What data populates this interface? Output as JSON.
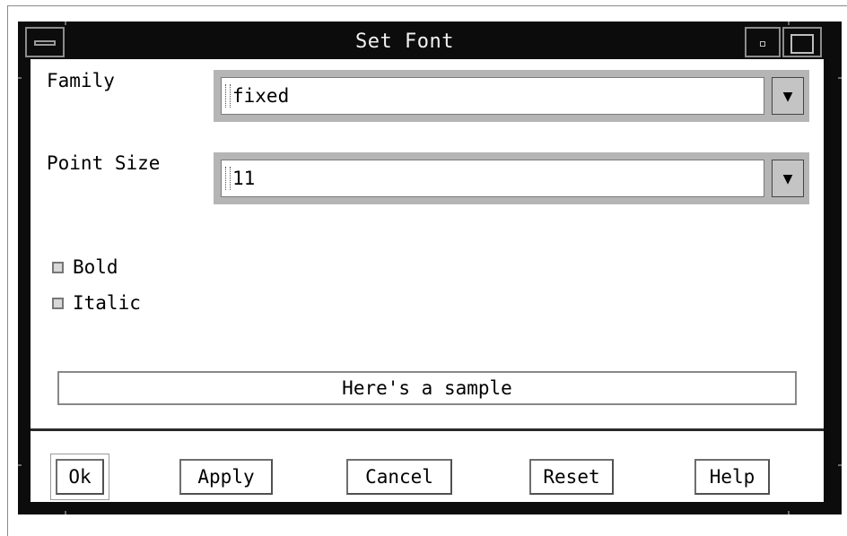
{
  "window": {
    "title": "Set Font"
  },
  "family": {
    "label": "Family",
    "value": "fixed"
  },
  "point_size": {
    "label": "Point Size",
    "value": "11"
  },
  "options": {
    "bold": {
      "label": "Bold",
      "checked": false
    },
    "italic": {
      "label": "Italic",
      "checked": false
    }
  },
  "sample": {
    "text": "Here's a sample"
  },
  "buttons": {
    "ok": "Ok",
    "apply": "Apply",
    "cancel": "Cancel",
    "reset": "Reset",
    "help": "Help"
  },
  "icons": {
    "dropdown": "triangle-down-icon",
    "window_menu": "window-menu-icon",
    "minimize": "minimize-icon",
    "maximize": "maximize-icon"
  },
  "colors": {
    "titlebar": "#0c0c0c",
    "field_bevel": "#b5b5b5",
    "client_bg": "#ffffff"
  }
}
